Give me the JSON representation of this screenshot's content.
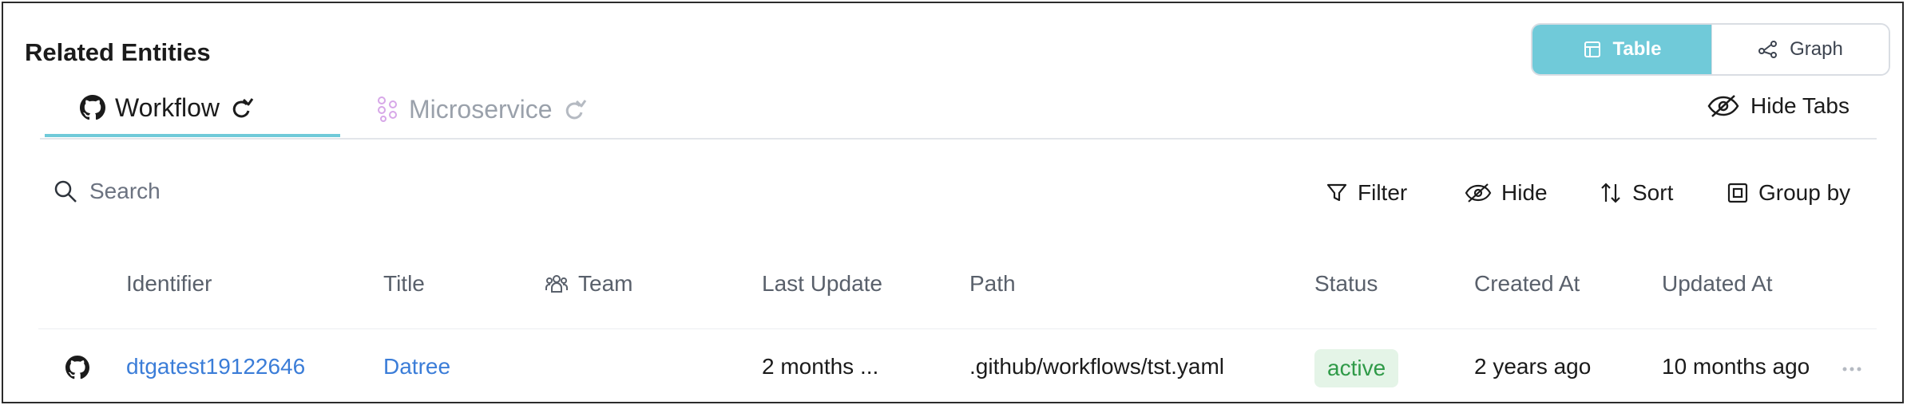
{
  "header": {
    "title": "Related Entities"
  },
  "view_toggle": {
    "table_label": "Table",
    "graph_label": "Graph"
  },
  "tabs": [
    {
      "label": "Workflow",
      "icon": "github-icon",
      "active": true
    },
    {
      "label": "Microservice",
      "icon": "microservice-icon",
      "active": false
    }
  ],
  "hide_tabs_label": "Hide Tabs",
  "search": {
    "placeholder": "Search"
  },
  "toolbar": {
    "filter": "Filter",
    "hide": "Hide",
    "sort": "Sort",
    "group_by": "Group by"
  },
  "columns": [
    "Identifier",
    "Title",
    "Team",
    "Last Update",
    "Path",
    "Status",
    "Created At",
    "Updated At"
  ],
  "rows": [
    {
      "icon": "github-icon",
      "identifier": "dtgatest19122646",
      "title": "Datree",
      "team": "",
      "last_update": "2 months ...",
      "path": ".github/workflows/tst.yaml",
      "status": "active",
      "created_at": "2 years ago",
      "updated_at": "10 months ago"
    }
  ],
  "colors": {
    "accent": "#70cad9",
    "link": "#3b7dd8",
    "status_active_bg": "#e4f4e7",
    "status_active_text": "#2f9a48"
  }
}
